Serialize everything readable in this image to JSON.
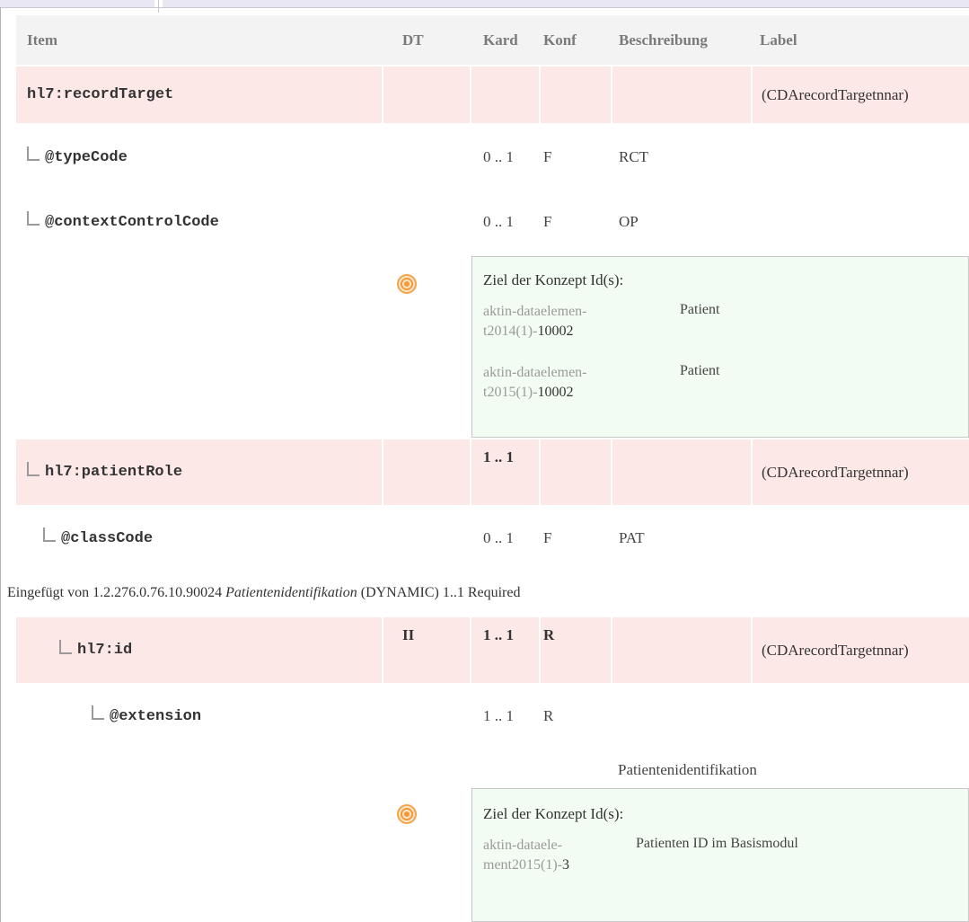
{
  "header": {
    "item": "Item",
    "dt": "DT",
    "kard": "Kard",
    "konf": "Konf",
    "beschreibung": "Beschreibung",
    "label": "Label"
  },
  "rows": {
    "recordTarget": {
      "item": "hl7:recordTarget",
      "label": "(CDArecordTargetnnar)"
    },
    "typeCode": {
      "item": "@typeCode",
      "kard": "0 .. 1",
      "konf": "F",
      "beschreibung": "RCT"
    },
    "contextControlCode": {
      "item": "@contextControlCode",
      "kard": "0 .. 1",
      "konf": "F",
      "beschreibung": "OP"
    },
    "patientRole": {
      "item": "hl7:patientRole",
      "kard": "1 .. 1",
      "label": "(CDArecordTargetnnar)"
    },
    "classCode": {
      "item": "@classCode",
      "kard": "0 .. 1",
      "konf": "F",
      "beschreibung": "PAT"
    },
    "id": {
      "item": "hl7:id",
      "dt": "II",
      "kard": "1 .. 1",
      "konf": "R",
      "label": "(CDArecordTargetnnar)"
    },
    "extension": {
      "item": "@extension",
      "kard": "1 .. 1",
      "konf": "R"
    }
  },
  "concepts1": {
    "heading": "Ziel der Konzept Id(s):",
    "items": [
      {
        "id_prefix": "aktin-dataelemen-",
        "id_suffix": "t2014(1)-",
        "id_num": "10002",
        "name": "Patient"
      },
      {
        "id_prefix": "aktin-dataelemen-",
        "id_suffix": "t2015(1)-",
        "id_num": "10002",
        "name": "Patient"
      }
    ]
  },
  "inserted_note": {
    "prefix": "Eingefügt von 1.2.276.0.76.10.90024 ",
    "name": "Patientenidentifikation",
    "suffix": " (DYNAMIC) 1..1 Required"
  },
  "extension_concept_label": "Patientenidentifikation",
  "concepts2": {
    "heading": "Ziel der Konzept Id(s):",
    "items": [
      {
        "id_prefix": "aktin-dataele-",
        "id_suffix": "ment2015(1)-",
        "id_num": "3",
        "name": "Patienten ID im Basismodul"
      }
    ]
  },
  "icons": {
    "concept_target": "target-icon"
  }
}
